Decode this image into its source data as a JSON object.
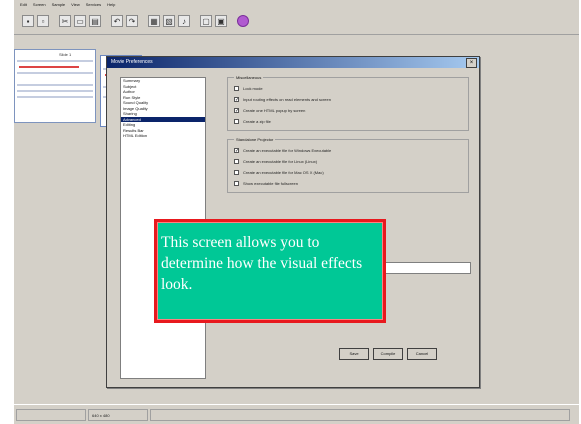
{
  "menu": {
    "items": [
      "Edit",
      "Screen",
      "Sample",
      "View",
      "Services",
      "Help"
    ]
  },
  "toolbar": {
    "icons": [
      "new-icon",
      "save-icon",
      "cut-icon",
      "copy-icon",
      "paste-icon",
      "undo-icon",
      "redo-icon",
      "insert-icon",
      "image-icon",
      "audio-icon",
      "preview-icon",
      "publish-icon",
      "help-icon"
    ]
  },
  "slide": {
    "caption": "Slide 1"
  },
  "dialog": {
    "title": "Movie Preferences",
    "close_label": "×",
    "nav": [
      "Summary",
      "Subject",
      "Author",
      "Run Style",
      "Sound Quality",
      "Image Quality",
      "Sharing",
      "Advanced",
      "Editing",
      "Results Bar",
      "HTML Edition"
    ],
    "selected_index": 7,
    "groups": {
      "misc": {
        "title": "Miscellaneous",
        "options": [
          {
            "label": "Lock mode",
            "checked": false
          },
          {
            "label": "Input routing effects on read elements and screen",
            "checked": true
          },
          {
            "label": "Create one HTML popup by screen",
            "checked": true
          },
          {
            "label": "Create a zip file",
            "checked": false
          }
        ]
      },
      "standalone": {
        "title": "Standalone Projector",
        "options": [
          {
            "label": "Create an executable file for Windows Executable",
            "checked": true
          },
          {
            "label": "Create an executable file for Linux (Linux)",
            "checked": false
          },
          {
            "label": "Create an executable file for Mac OS X (Mac)",
            "checked": false
          },
          {
            "label": "Show executable file fullscreen",
            "checked": false
          }
        ]
      }
    },
    "buttons": {
      "save": "Save",
      "compile": "Compile",
      "cancel": "Cancel"
    }
  },
  "callout": {
    "text": "This screen allows you to determine how the visual effects look."
  },
  "status": {
    "left": "",
    "size": "640 x 480"
  }
}
